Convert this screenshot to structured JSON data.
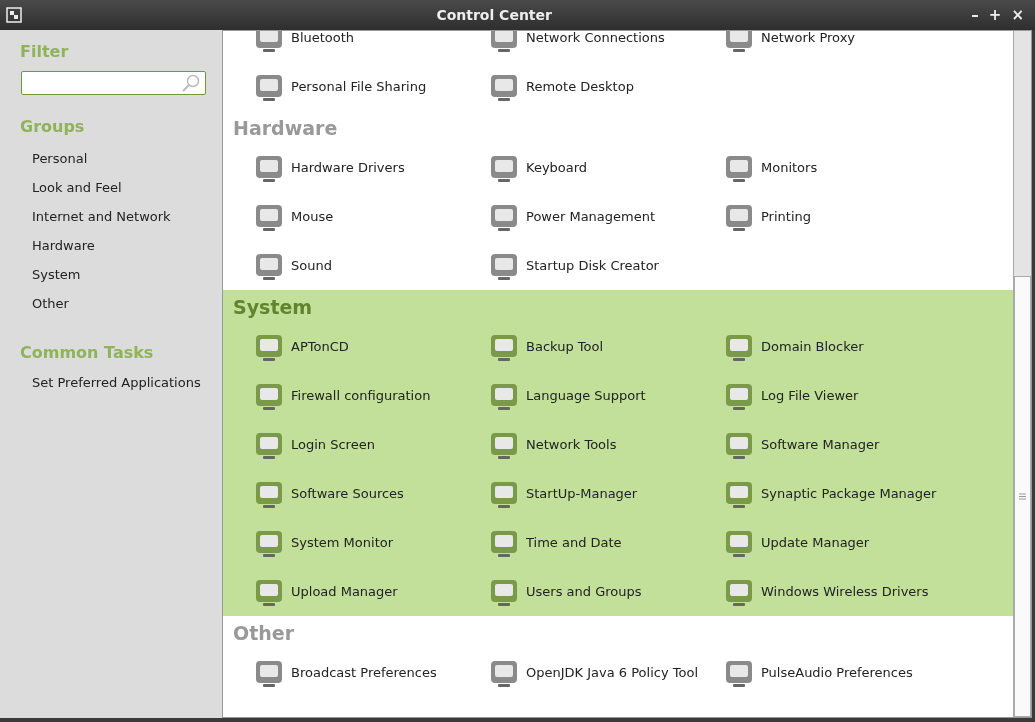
{
  "window": {
    "title": "Control Center",
    "controls": [
      "–",
      "+",
      "×"
    ]
  },
  "sidebar": {
    "filter_heading": "Filter",
    "groups_heading": "Groups",
    "groups": [
      {
        "label": "Personal"
      },
      {
        "label": "Look and Feel"
      },
      {
        "label": "Internet and Network"
      },
      {
        "label": "Hardware"
      },
      {
        "label": "System"
      },
      {
        "label": "Other"
      }
    ],
    "tasks_heading": "Common Tasks",
    "tasks": [
      {
        "label": "Set Preferred Applications"
      }
    ]
  },
  "sections": [
    {
      "highlighted": false,
      "items": [
        "Bluetooth",
        "Network Connections",
        "Network Proxy",
        "Personal File Sharing",
        "Remote Desktop"
      ]
    },
    {
      "title": "Hardware",
      "highlighted": false,
      "items": [
        "Hardware Drivers",
        "Keyboard",
        "Monitors",
        "Mouse",
        "Power Management",
        "Printing",
        "Sound",
        "Startup Disk Creator"
      ]
    },
    {
      "title": "System",
      "highlighted": true,
      "items": [
        "APTonCD",
        "Backup Tool",
        "Domain Blocker",
        "Firewall configuration",
        "Language Support",
        "Log File Viewer",
        "Login Screen",
        "Network Tools",
        "Software Manager",
        "Software Sources",
        "StartUp-Manager",
        "Synaptic Package Manager",
        "System Monitor",
        "Time and Date",
        "Update Manager",
        "Upload Manager",
        "Users and Groups",
        "Windows Wireless Drivers"
      ]
    },
    {
      "title": "Other",
      "highlighted": false,
      "items": [
        "Broadcast Preferences",
        "OpenJDK Java 6 Policy Tool",
        "PulseAudio Preferences"
      ]
    }
  ]
}
